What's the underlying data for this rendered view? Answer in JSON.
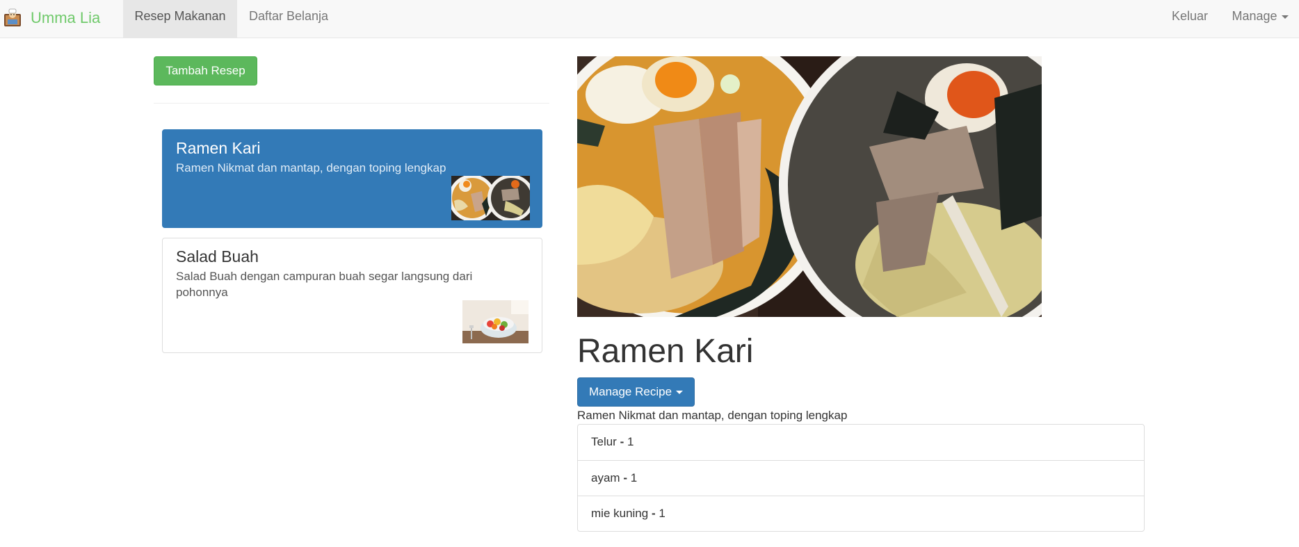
{
  "navbar": {
    "brand_name": "Umma Lia",
    "brand_icon": "chef-logo-icon",
    "brand_color": "#6fc96a",
    "tabs": [
      {
        "label": "Resep Makanan",
        "active": true
      },
      {
        "label": "Daftar Belanja",
        "active": false
      }
    ],
    "right": {
      "logout_label": "Keluar",
      "manage_label": "Manage"
    }
  },
  "sidebar": {
    "add_button_label": "Tambah Resep",
    "recipes": [
      {
        "title": "Ramen Kari",
        "description": "Ramen Nikmat dan mantap, dengan toping lengkap",
        "active": true,
        "thumb_icon": "ramen-thumbnail"
      },
      {
        "title": "Salad Buah",
        "description": "Salad Buah dengan campuran buah segar langsung dari pohonnya",
        "active": false,
        "thumb_icon": "fruit-salad-thumbnail"
      }
    ]
  },
  "detail": {
    "image_icon": "ramen-photo",
    "title": "Ramen Kari",
    "manage_button_label": "Manage Recipe",
    "description": "Ramen Nikmat dan mantap, dengan toping lengkap",
    "ingredients": [
      {
        "name": "Telur",
        "separator": "-",
        "amount": "1"
      },
      {
        "name": "ayam",
        "separator": "-",
        "amount": "1"
      },
      {
        "name": "mie kuning",
        "separator": "-",
        "amount": "1"
      }
    ]
  },
  "colors": {
    "primary": "#337ab7",
    "success": "#5cb85c",
    "navbar_bg": "#f8f8f8"
  }
}
